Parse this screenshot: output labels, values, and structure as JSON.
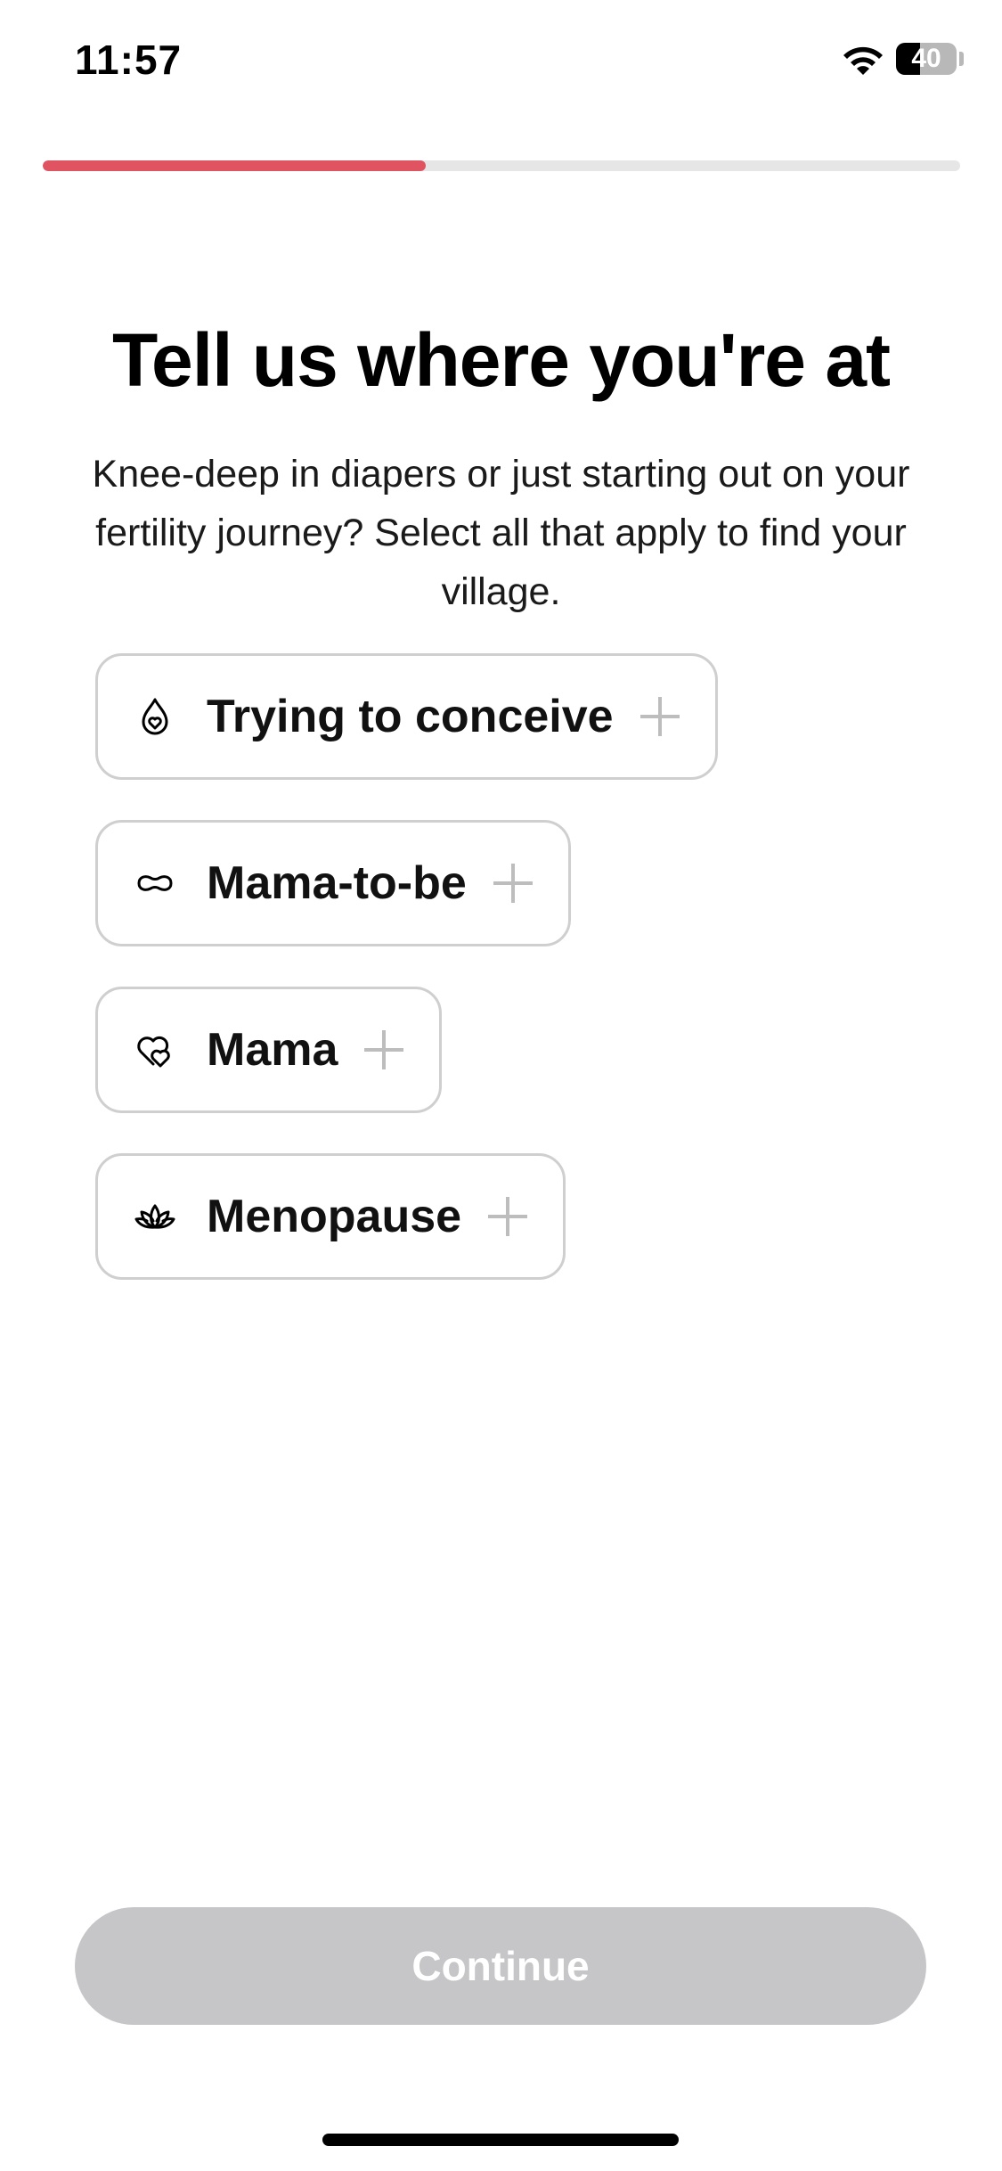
{
  "status_bar": {
    "time": "11:57",
    "battery_level": "40",
    "battery_fraction": 0.4
  },
  "progress": {
    "fraction": 0.417,
    "color": "#e05461"
  },
  "header": {
    "title": "Tell us where you're at",
    "subtitle": "Knee-deep in diapers or just starting out on your fertility journey? Select all that apply to find your village."
  },
  "options": [
    {
      "label": "Trying to conceive",
      "icon": "drop-heart-icon"
    },
    {
      "label": "Mama-to-be",
      "icon": "bean-icon"
    },
    {
      "label": "Mama",
      "icon": "double-heart-icon"
    },
    {
      "label": "Menopause",
      "icon": "lotus-icon"
    }
  ],
  "footer": {
    "continue_label": "Continue"
  }
}
